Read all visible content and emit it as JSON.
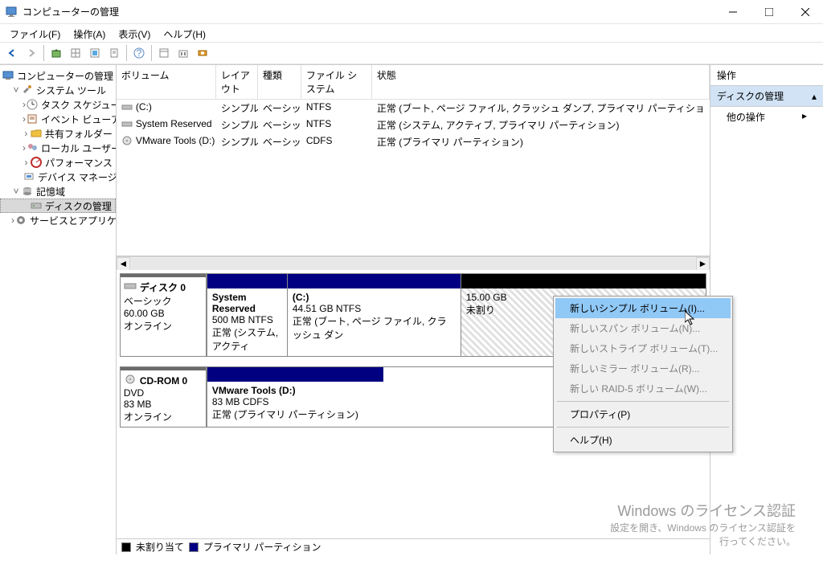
{
  "window": {
    "title": "コンピューターの管理"
  },
  "menu": {
    "file": "ファイル(F)",
    "action": "操作(A)",
    "view": "表示(V)",
    "help": "ヘルプ(H)"
  },
  "tree": {
    "root": "コンピューターの管理 (ローカル)",
    "system_tools": "システム ツール",
    "task_scheduler": "タスク スケジューラ",
    "event_viewer": "イベント ビューアー",
    "shared_folders": "共有フォルダー",
    "local_users": "ローカル ユーザーとグループ",
    "performance": "パフォーマンス",
    "device_manager": "デバイス マネージャー",
    "storage": "記憶域",
    "disk_management": "ディスクの管理",
    "services_apps": "サービスとアプリケーション"
  },
  "vol_cols": {
    "volume": "ボリューム",
    "layout": "レイアウト",
    "type": "種類",
    "fs": "ファイル システム",
    "status": "状態"
  },
  "volumes": [
    {
      "name": "(C:)",
      "layout": "シンプル",
      "type": "ベーシック",
      "fs": "NTFS",
      "status": "正常 (ブート, ページ ファイル, クラッシュ ダンプ, プライマリ パーティショ"
    },
    {
      "name": "System Reserved",
      "layout": "シンプル",
      "type": "ベーシック",
      "fs": "NTFS",
      "status": "正常 (システム, アクティブ, プライマリ パーティション)"
    },
    {
      "name": "VMware Tools (D:)",
      "layout": "シンプル",
      "type": "ベーシック",
      "fs": "CDFS",
      "status": "正常 (プライマリ パーティション)"
    }
  ],
  "disk0": {
    "name": "ディスク 0",
    "type": "ベーシック",
    "size": "60.00 GB",
    "state": "オンライン",
    "p1_name": "System Reserved",
    "p1_size": "500 MB NTFS",
    "p1_status": "正常 (システム, アクティ",
    "p2_name": "(C:)",
    "p2_size": "44.51 GB NTFS",
    "p2_status": "正常 (ブート, ページ ファイル, クラッシュ ダン",
    "p3_size": "15.00 GB",
    "p3_status": "未割り"
  },
  "cdrom": {
    "name": "CD-ROM 0",
    "type": "DVD",
    "size": "83 MB",
    "state": "オンライン",
    "p1_name": "VMware Tools  (D:)",
    "p1_size": "83 MB CDFS",
    "p1_status": "正常 (プライマリ パーティション)"
  },
  "legend": {
    "unalloc": "未割り当て",
    "primary": "プライマリ パーティション"
  },
  "actions": {
    "title": "操作",
    "section": "ディスクの管理",
    "more": "他の操作"
  },
  "ctx": {
    "simple": "新しいシンプル ボリューム(I)...",
    "span": "新しいスパン ボリューム(N)...",
    "stripe": "新しいストライプ ボリューム(T)...",
    "mirror": "新しいミラー ボリューム(R)...",
    "raid5": "新しい RAID-5 ボリューム(W)...",
    "properties": "プロパティ(P)",
    "help": "ヘルプ(H)"
  },
  "watermark": {
    "line1": "Windows のライセンス認証",
    "line2": "設定を開き、Windows のライセンス認証を",
    "line3": "行ってください。"
  }
}
